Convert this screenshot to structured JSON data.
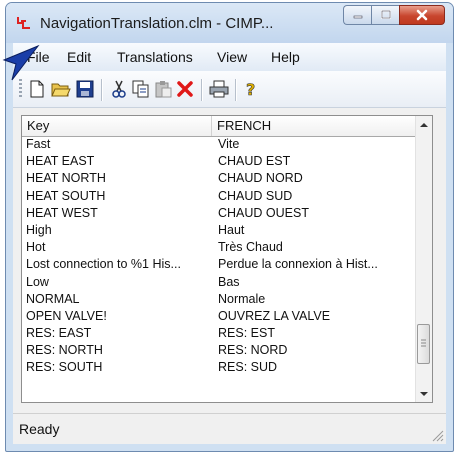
{
  "window": {
    "title": "NavigationTranslation.clm - CIMP..."
  },
  "menu": [
    "File",
    "Edit",
    "Translations",
    "View",
    "Help"
  ],
  "toolbar": {
    "icons": [
      "new-file-icon",
      "open-folder-icon",
      "save-icon",
      "cut-icon",
      "copy-icon",
      "paste-icon",
      "delete-icon",
      "print-icon",
      "help-icon"
    ]
  },
  "table": {
    "columns": [
      "Key",
      "FRENCH"
    ],
    "rows": [
      [
        "Fast",
        "Vite"
      ],
      [
        "HEAT EAST",
        "CHAUD EST"
      ],
      [
        "HEAT NORTH",
        "CHAUD NORD"
      ],
      [
        "HEAT SOUTH",
        "CHAUD SUD"
      ],
      [
        "HEAT WEST",
        "CHAUD OUEST"
      ],
      [
        "High",
        "Haut"
      ],
      [
        "Hot",
        "Très Chaud"
      ],
      [
        "Lost connection to %1 His...",
        "Perdue la connexion à Hist..."
      ],
      [
        "Low",
        "Bas"
      ],
      [
        "NORMAL",
        "Normale"
      ],
      [
        "OPEN VALVE!",
        "OUVREZ LA VALVE"
      ],
      [
        "RES: EAST",
        "RES: EST"
      ],
      [
        "RES: NORTH",
        "RES: NORD"
      ],
      [
        "RES: SOUTH",
        "RES: SUD"
      ]
    ]
  },
  "status": {
    "text": "Ready"
  },
  "colors": {
    "title_bar": "#c2d6ee",
    "close_button": "#c8462e"
  }
}
